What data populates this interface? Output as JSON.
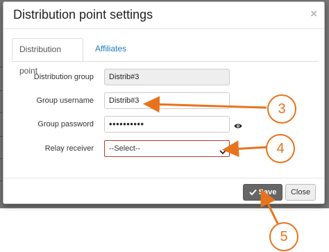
{
  "modal": {
    "title": "Distribution point settings",
    "close_glyph": "×"
  },
  "tabs": [
    {
      "label": "Distribution point",
      "active": true
    },
    {
      "label": "Affiliates",
      "active": false
    }
  ],
  "form": {
    "distribution_group": {
      "label": "Distribution group",
      "value": "Distrib#3"
    },
    "group_username": {
      "label": "Group username",
      "value": "Distrib#3"
    },
    "group_password": {
      "label": "Group password",
      "value": "••••••••••"
    },
    "relay_receiver": {
      "label": "Relay receiver",
      "value": "--Select--"
    }
  },
  "footer": {
    "save_label": "Save",
    "close_label": "Close"
  },
  "annotations": {
    "callout_3": "3",
    "callout_4": "4",
    "callout_5": "5",
    "color": "#e8731d"
  },
  "icons": {
    "eye": "eye-icon",
    "check": "check-icon",
    "chevron": "chevron-down-icon"
  }
}
